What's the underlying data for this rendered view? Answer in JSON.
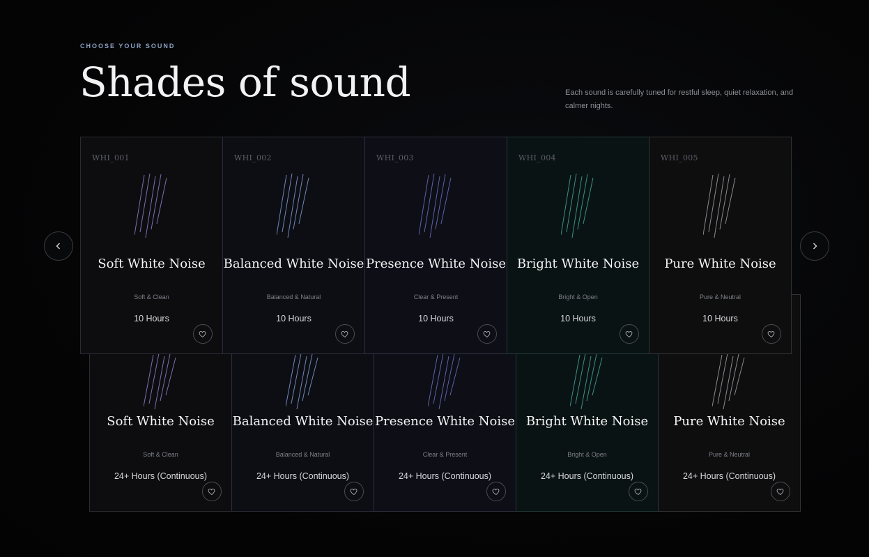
{
  "header": {
    "eyebrow": "CHOOSE YOUR SOUND",
    "title": "Shades of sound",
    "description": "Each sound is carefully tuned for restful sleep, quiet relaxation, and calmer nights."
  },
  "colors": {
    "accent_soft": "#7b6fb0",
    "accent_balanced": "#6f86b8",
    "accent_presence": "#5c63a8",
    "accent_bright": "#3a8f8a",
    "accent_pure": "#8a8a8e"
  },
  "icons": {
    "prev": "chevron-left-icon",
    "next": "chevron-right-icon",
    "favorite": "heart-icon",
    "waveform": "diagonal-lines-icon"
  },
  "front_cards": [
    {
      "code": "WHI_001",
      "name": "Soft White Noise",
      "subtitle": "Soft & Clean",
      "duration": "10 Hours"
    },
    {
      "code": "WHI_002",
      "name": "Balanced White Noise",
      "subtitle": "Balanced & Natural",
      "duration": "10 Hours"
    },
    {
      "code": "WHI_003",
      "name": "Presence White Noise",
      "subtitle": "Clear & Present",
      "duration": "10 Hours"
    },
    {
      "code": "WHI_004",
      "name": "Bright White Noise",
      "subtitle": "Bright & Open",
      "duration": "10 Hours"
    },
    {
      "code": "WHI_005",
      "name": "Pure White Noise",
      "subtitle": "Pure & Neutral",
      "duration": "10 Hours"
    }
  ],
  "back_cards": [
    {
      "name": "Soft White Noise",
      "subtitle": "Soft & Clean",
      "duration": "24+ Hours (Continuous)"
    },
    {
      "name": "Balanced White Noise",
      "subtitle": "Balanced & Natural",
      "duration": "24+ Hours (Continuous)"
    },
    {
      "name": "Presence White Noise",
      "subtitle": "Clear & Present",
      "duration": "24+ Hours (Continuous)"
    },
    {
      "name": "Bright White Noise",
      "subtitle": "Bright & Open",
      "duration": "24+ Hours (Continuous)"
    },
    {
      "name": "Pure White Noise",
      "subtitle": "Pure & Neutral",
      "duration": "24+ Hours (Continuous)"
    }
  ]
}
